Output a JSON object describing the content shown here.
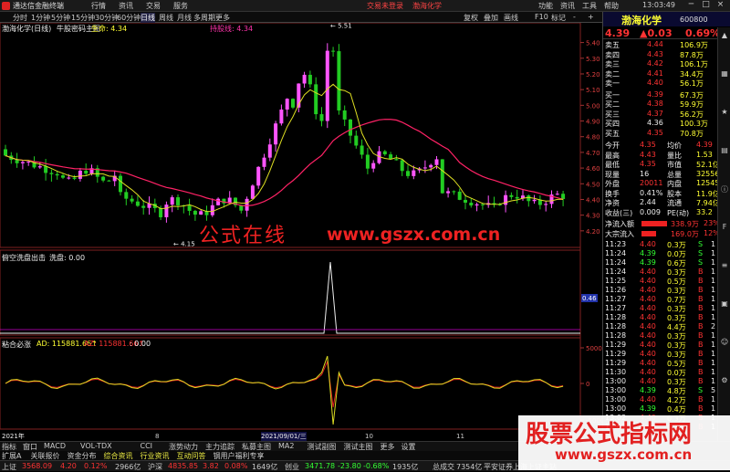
{
  "titlebar": {
    "app": "通达信金融终端",
    "menus": [
      "行情",
      "资讯",
      "交易",
      "服务"
    ],
    "center": [
      "交易未登录",
      "渤海化学"
    ],
    "right": [
      "功能",
      "资讯",
      "工具",
      "帮助"
    ],
    "clock": "13:03:49",
    "win": [
      "─",
      "□",
      "×"
    ]
  },
  "toolbar": {
    "periods": [
      "分时",
      "1分钟",
      "5分钟",
      "15分钟",
      "30分钟",
      "60分钟",
      "日线",
      "周线",
      "月线",
      "多周期",
      "更多"
    ],
    "active": "日线",
    "right": [
      "复权",
      "叠加",
      "画线",
      "F10",
      "标记",
      "-",
      "+"
    ]
  },
  "chart": {
    "title": "渤海化学(日线)",
    "indicator_name": "牛股密码主图",
    "indicator_val": "生命: 4.34",
    "ind2": "持股线: 4.34",
    "axis": [
      "5.40",
      "5.30",
      "5.20",
      "5.10",
      "5.00",
      "4.90",
      "4.80",
      "4.70",
      "4.60",
      "4.50",
      "4.40",
      "4.30",
      "4.20"
    ],
    "high_label": "5.51",
    "low_label": "4.15",
    "sub1_title": "俯空洗盘出击",
    "sub1_val": "洗盘: 0.00",
    "sub1_axis": "0.46",
    "sub2_title": "粘合必涨",
    "sub2_ad": "AD: 115881.66↑",
    "sub2_az": "AZ: 115881.66↑",
    "sub2_val": ": 0.00",
    "sub2_axis": [
      "5000",
      "0",
      "-5000"
    ],
    "date_left": "2021年",
    "date_mid": "2021/09/01/三",
    "date_ticks": [
      "8",
      "10",
      "11"
    ],
    "colors": {
      "up": "#ff55ff",
      "down": "#22cc22",
      "ma_slow": "#ff2266",
      "ma_fast": "#dddd22"
    }
  },
  "chart_data": {
    "type": "candlestick",
    "y_range": [
      4.15,
      5.51
    ],
    "high": 5.51,
    "low": 4.15,
    "last": 4.39
  },
  "tabs": [
    "指标",
    "窗口",
    "MACD",
    "VOL-TDX",
    "CCI",
    "涨势动力",
    "主力追踪",
    "私募主图",
    "MA2",
    "测试副图",
    "测试主图",
    "更多",
    "设置"
  ],
  "tabs2": [
    "扩展A",
    "关联报价",
    "资金分布",
    "综合资讯",
    "行业资讯",
    "互动问答",
    "钢用户福利专享"
  ],
  "quote": {
    "name": "渤海化学",
    "code": "600800",
    "price": "4.39",
    "change": "▲0.03",
    "pct": "0.69%",
    "asks": [
      {
        "l": "卖五",
        "p": "4.44",
        "v": "106.9万"
      },
      {
        "l": "卖四",
        "p": "4.43",
        "v": "87.8万"
      },
      {
        "l": "卖三",
        "p": "4.42",
        "v": "106.1万"
      },
      {
        "l": "卖二",
        "p": "4.41",
        "v": "34.4万"
      },
      {
        "l": "卖一",
        "p": "4.40",
        "v": "56.1万"
      }
    ],
    "bids": [
      {
        "l": "买一",
        "p": "4.39",
        "v": "67.3万"
      },
      {
        "l": "买二",
        "p": "4.38",
        "v": "59.9万"
      },
      {
        "l": "买三",
        "p": "4.37",
        "v": "56.2万"
      },
      {
        "l": "买四",
        "p": "4.36",
        "v": "100.3万"
      },
      {
        "l": "买五",
        "p": "4.35",
        "v": "70.8万"
      }
    ],
    "stats": [
      [
        "今开",
        "4.35",
        "均价",
        "4.39"
      ],
      [
        "最高",
        "4.43",
        "量比",
        "1.53"
      ],
      [
        "最低",
        "4.35",
        "市值",
        "52.1亿"
      ],
      [
        "现量",
        "16",
        "总量",
        "32556"
      ],
      [
        "外盘",
        "20011",
        "内盘",
        "12545"
      ],
      [
        "换手",
        "0.41%",
        "股本",
        "11.9亿"
      ],
      [
        "净资",
        "2.44",
        "流通",
        "7.94亿"
      ],
      [
        "收益(三)",
        "0.009",
        "PE(动)",
        "33.2"
      ]
    ],
    "flow": [
      {
        "l": "净流入额",
        "v": "338.9万",
        "p": "23%"
      },
      {
        "l": "大宗流入",
        "v": "169.0万",
        "p": "12%"
      }
    ],
    "ticks": [
      [
        "11:23",
        "4.40",
        "0.3万",
        "S",
        "1"
      ],
      [
        "11:24",
        "4.39",
        "0.0万",
        "S",
        "1"
      ],
      [
        "11:24",
        "4.39",
        "0.6万",
        "S",
        "1"
      ],
      [
        "11:24",
        "4.40",
        "0.3万",
        "B",
        "1"
      ],
      [
        "11:25",
        "4.40",
        "0.5万",
        "B",
        "1"
      ],
      [
        "11:26",
        "4.40",
        "0.3万",
        "B",
        "1"
      ],
      [
        "11:27",
        "4.40",
        "0.7万",
        "B",
        "1"
      ],
      [
        "11:27",
        "4.40",
        "0.3万",
        "B",
        "1"
      ],
      [
        "11:28",
        "4.40",
        "0.3万",
        "B",
        "1"
      ],
      [
        "11:28",
        "4.40",
        "4.4万",
        "B",
        "2"
      ],
      [
        "11:28",
        "4.40",
        "0.3万",
        "B",
        "1"
      ],
      [
        "11:29",
        "4.40",
        "0.3万",
        "B",
        "1"
      ],
      [
        "11:29",
        "4.40",
        "0.3万",
        "B",
        "1"
      ],
      [
        "11:29",
        "4.40",
        "0.5万",
        "B",
        "1"
      ],
      [
        "11:30",
        "4.40",
        "0.0万",
        "B",
        "1"
      ],
      [
        "13:00",
        "4.40",
        "0.3万",
        "B",
        "1"
      ],
      [
        "13:00",
        "4.39",
        "4.8万",
        "S",
        "5"
      ],
      [
        "13:00",
        "4.40",
        "4.2万",
        "B",
        "1"
      ],
      [
        "13:00",
        "4.39",
        "0.4万",
        "B",
        "1"
      ],
      [
        "13:02",
        "4.40",
        "0.3万",
        "B",
        "1"
      ],
      [
        "13:02",
        "4.40",
        "0.3万",
        "B",
        "1"
      ]
    ]
  },
  "status": {
    "sh": "上证",
    "sh_v": "3568.09",
    "sh_c": "4.20",
    "sh_p": "0.12%",
    "sh_a": "2966亿",
    "sz": "沪深",
    "sz_v": "4835.85",
    "sz_c": "3.82",
    "sz_p": "0.08%",
    "sz_a": "1649亿",
    "cy": "创业",
    "cy_v": "3471.78",
    "cy_c": "-23.80",
    "cy_p": "-0.68%",
    "cy_a": "1935亿",
    "tot": "总成交",
    "tot_v": "7354亿",
    "broker": "平安证券上海上证主站"
  },
  "watermark": {
    "t1": "公式在线",
    "t2": "www.gszx.com.cn",
    "t3": "股票公式指标网",
    "t4": "www.gszx.com.cn"
  },
  "icons": [
    "scroll-up-icon",
    "grid-icon",
    "star-icon",
    "chart-icon",
    "info-icon",
    "f-icon",
    "list-icon",
    "doc-icon",
    "user-icon",
    "gear-icon"
  ]
}
